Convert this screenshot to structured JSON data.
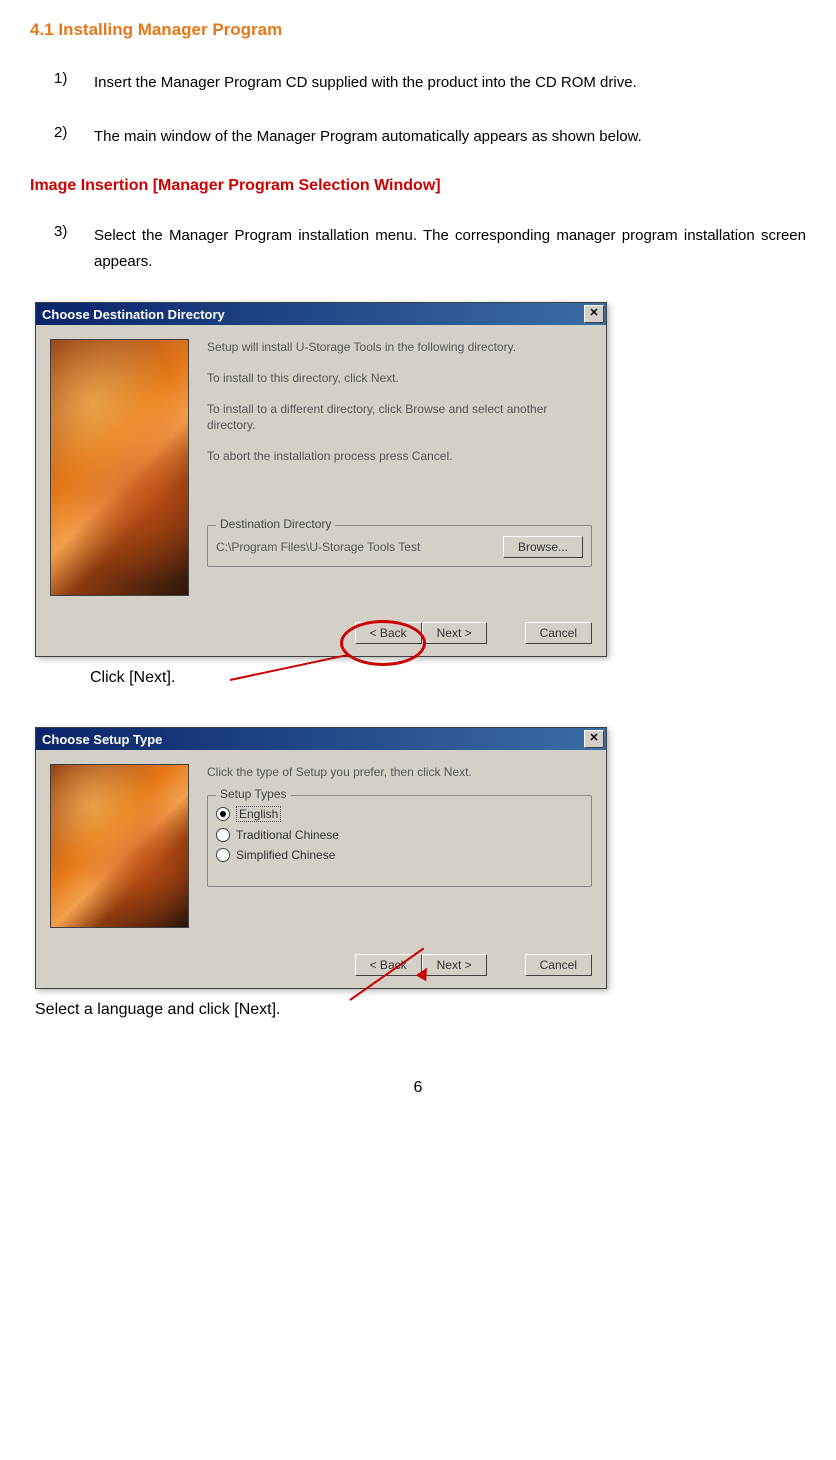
{
  "section_heading": "4.1 Installing Manager Program",
  "list": {
    "items": [
      {
        "marker": "1)",
        "text": "Insert the Manager Program CD supplied with the product into the CD ROM drive."
      },
      {
        "marker": "2)",
        "text": "The main window of the Manager Program automatically appears as shown below."
      },
      {
        "marker": "3)",
        "text": "Select the Manager Program installation menu. The corresponding manager program installation screen appears."
      }
    ]
  },
  "image_insertion_label": "Image Insertion [Manager Program Selection Window]",
  "dialog1": {
    "title": "Choose Destination Directory",
    "line1": "Setup will install U-Storage Tools in the following directory.",
    "line2": "To install to this directory, click Next.",
    "line3": "To install to a different directory, click Browse and select another directory.",
    "line4": "To abort the installation process press Cancel.",
    "dest_legend": "Destination Directory",
    "dest_path": "C:\\Program Files\\U-Storage Tools Test",
    "browse_btn": "Browse...",
    "back_btn": "< Back",
    "next_btn": "Next >",
    "cancel_btn": "Cancel"
  },
  "click_next_caption": "Click [Next].",
  "dialog2": {
    "title": "Choose Setup Type",
    "line1": "Click the type of Setup you prefer, then click Next.",
    "setup_legend": "Setup Types",
    "options": [
      "English",
      "Traditional Chinese",
      "Simplified Chinese"
    ],
    "back_btn": "< Back",
    "next_btn": "Next >",
    "cancel_btn": "Cancel"
  },
  "final_caption": "Select a language and click [Next].",
  "page_number": "6"
}
